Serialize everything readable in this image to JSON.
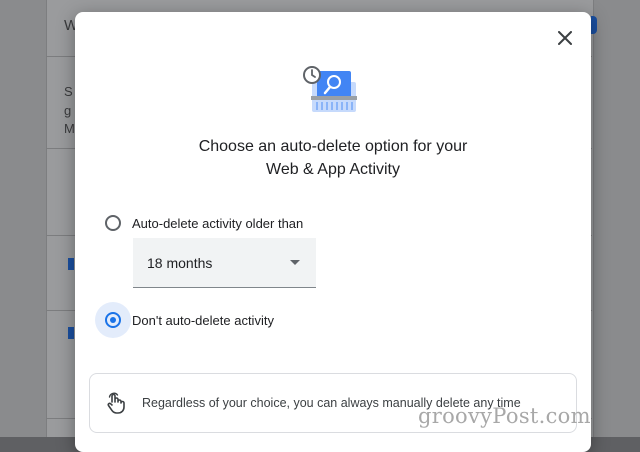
{
  "background": {
    "fragments": [
      "W",
      "S",
      "g",
      "M"
    ]
  },
  "dialog": {
    "close_icon": "close-icon",
    "hero_icon": "auto-delete-illustration",
    "heading_line1": "Choose an auto-delete option for your",
    "heading_line2": "Web & App Activity",
    "options": [
      {
        "label": "Auto-delete activity older than",
        "selected": false
      },
      {
        "label": "Don't auto-delete activity",
        "selected": true
      }
    ],
    "select": {
      "value": "18 months",
      "icon": "dropdown-arrow-icon"
    },
    "info": {
      "icon": "hand-tap-icon",
      "text": "Regardless of your choice, you can always manually delete any time"
    }
  },
  "watermark": "groovyPost.com",
  "colors": {
    "accent": "#1a73e8",
    "overlay": "#8a8b8d"
  }
}
